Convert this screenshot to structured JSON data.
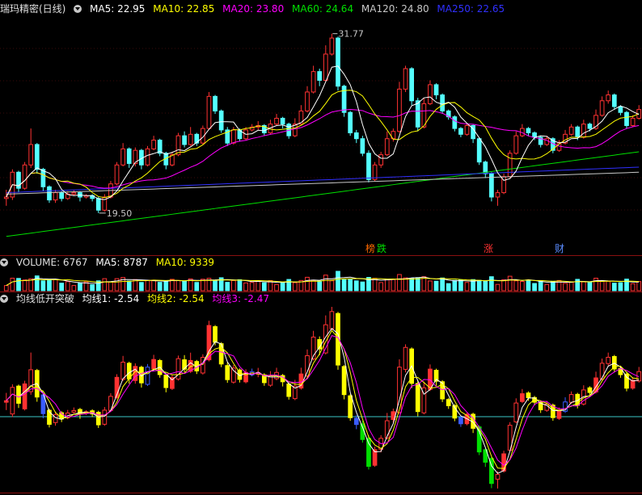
{
  "header": {
    "title": "瑞玛精密(日线)",
    "ma5": "MA5: 22.95",
    "ma10": "MA10: 22.85",
    "ma20": "MA20: 23.80",
    "ma60": "MA60: 24.64",
    "ma120": "MA120: 24.80",
    "ma250": "MA250: 22.65"
  },
  "volume_header": {
    "label": "VOLUME: 6767",
    "ma5": "MA5: 8787",
    "ma10": "MA10: 9339"
  },
  "indicator_header": {
    "label": "均线低开突破",
    "l1": "均线1: -2.54",
    "l2": "均线2: -2.54",
    "l3": "均线3: -2.47"
  },
  "tags": {
    "t1": "榜",
    "t2": "跌",
    "t3": "涨",
    "t4": "财"
  },
  "colors": {
    "up": "#ff3232",
    "down": "#54ffff",
    "ma5": "#ffffff",
    "ma10": "#ffff00",
    "ma20": "#ff00ff",
    "ma60": "#00e000",
    "ma120": "#c8c8c8",
    "ma250": "#3030ff",
    "separator": "#8a1010"
  },
  "chart_data": [
    {
      "type": "candlestick",
      "title": "瑞玛精密(日线)",
      "annotations": [
        {
          "text": "31.77",
          "label": "high"
        },
        {
          "text": "19.50",
          "label": "low"
        }
      ],
      "ylim": [
        17.5,
        33
      ],
      "series": [
        {
          "name": "MA5",
          "value": 22.95
        },
        {
          "name": "MA10",
          "value": 22.85
        },
        {
          "name": "MA20",
          "value": 23.8
        },
        {
          "name": "MA60",
          "value": 24.64
        },
        {
          "name": "MA120",
          "value": 24.8
        },
        {
          "name": "MA250",
          "value": 22.65
        }
      ],
      "candles": [
        [
          20.5,
          20.6,
          21.1,
          20.0
        ],
        [
          20.6,
          22.3,
          22.5,
          20.4
        ],
        [
          22.3,
          21.2,
          22.4,
          20.9
        ],
        [
          21.2,
          22.8,
          23.0,
          21.1
        ],
        [
          22.8,
          24.2,
          25.3,
          22.6
        ],
        [
          24.2,
          22.5,
          24.3,
          22.2
        ],
        [
          22.5,
          21.3,
          22.6,
          21.0
        ],
        [
          21.3,
          20.4,
          21.4,
          20.2
        ],
        [
          20.4,
          20.9,
          21.1,
          20.2
        ],
        [
          20.9,
          20.5,
          21.0,
          20.3
        ],
        [
          20.5,
          20.8,
          21.0,
          20.4
        ],
        [
          20.8,
          20.9,
          21.1,
          20.7
        ],
        [
          20.9,
          20.6,
          21.0,
          20.3
        ],
        [
          20.6,
          20.7,
          20.8,
          20.5
        ],
        [
          20.7,
          20.5,
          20.8,
          20.3
        ],
        [
          20.5,
          19.7,
          20.6,
          19.5
        ],
        [
          19.7,
          20.6,
          20.8,
          19.6
        ],
        [
          20.6,
          21.5,
          21.7,
          20.5
        ],
        [
          21.5,
          22.8,
          23.0,
          21.4
        ],
        [
          22.8,
          23.9,
          24.3,
          22.7
        ],
        [
          23.9,
          22.9,
          24.0,
          22.6
        ],
        [
          22.9,
          23.8,
          24.0,
          22.7
        ],
        [
          23.8,
          22.8,
          23.9,
          22.5
        ],
        [
          22.8,
          23.9,
          24.1,
          22.7
        ],
        [
          23.9,
          24.5,
          24.8,
          23.8
        ],
        [
          24.5,
          23.6,
          24.6,
          23.4
        ],
        [
          23.6,
          22.8,
          23.7,
          22.5
        ],
        [
          22.8,
          23.5,
          23.7,
          22.7
        ],
        [
          23.5,
          24.8,
          25.0,
          23.4
        ],
        [
          24.8,
          24.2,
          25.1,
          24.0
        ],
        [
          24.2,
          24.9,
          25.4,
          24.1
        ],
        [
          24.9,
          24.3,
          25.0,
          24.1
        ],
        [
          24.3,
          25.3,
          25.5,
          24.2
        ],
        [
          25.3,
          27.5,
          27.8,
          25.2
        ],
        [
          27.5,
          26.5,
          27.6,
          26.3
        ],
        [
          26.5,
          25.2,
          26.6,
          25.0
        ],
        [
          25.2,
          24.3,
          25.4,
          24.1
        ],
        [
          24.3,
          25.2,
          25.4,
          24.2
        ],
        [
          25.2,
          24.6,
          25.3,
          24.4
        ],
        [
          24.6,
          25.2,
          25.4,
          24.5
        ],
        [
          25.2,
          25.4,
          25.6,
          25.1
        ],
        [
          25.4,
          25.5,
          25.8,
          25.2
        ],
        [
          25.5,
          25.0,
          25.6,
          24.8
        ],
        [
          25.0,
          25.6,
          25.9,
          24.9
        ],
        [
          25.6,
          26.0,
          26.3,
          25.5
        ],
        [
          26.0,
          25.6,
          26.1,
          25.3
        ],
        [
          25.6,
          24.8,
          25.7,
          24.6
        ],
        [
          24.8,
          25.6,
          26.0,
          24.7
        ],
        [
          25.6,
          26.5,
          26.9,
          25.5
        ],
        [
          26.5,
          27.8,
          28.2,
          26.4
        ],
        [
          27.8,
          29.2,
          29.6,
          27.7
        ],
        [
          29.2,
          28.6,
          29.4,
          28.2
        ],
        [
          28.6,
          30.4,
          31.0,
          28.5
        ],
        [
          30.4,
          31.5,
          31.8,
          30.3
        ],
        [
          31.5,
          28.2,
          31.6,
          27.9
        ],
        [
          28.2,
          26.4,
          28.3,
          26.1
        ],
        [
          26.4,
          25.0,
          26.5,
          24.8
        ],
        [
          25.0,
          24.6,
          25.2,
          24.3
        ],
        [
          24.6,
          23.6,
          24.8,
          23.4
        ],
        [
          23.6,
          21.8,
          23.8,
          21.6
        ],
        [
          21.8,
          22.8,
          23.0,
          21.7
        ],
        [
          22.8,
          23.5,
          23.7,
          22.6
        ],
        [
          23.5,
          24.6,
          25.1,
          23.4
        ],
        [
          24.6,
          25.1,
          25.3,
          24.4
        ],
        [
          25.1,
          28.0,
          28.5,
          25.0
        ],
        [
          28.0,
          29.4,
          29.6,
          27.8
        ],
        [
          29.4,
          27.2,
          29.5,
          26.9
        ],
        [
          27.2,
          25.4,
          27.4,
          25.1
        ],
        [
          25.4,
          27.0,
          27.4,
          25.3
        ],
        [
          27.0,
          28.3,
          28.6,
          26.9
        ],
        [
          28.3,
          27.6,
          28.4,
          27.3
        ],
        [
          27.6,
          26.5,
          27.7,
          26.3
        ],
        [
          26.5,
          26.1,
          26.6,
          25.9
        ],
        [
          26.1,
          25.3,
          26.2,
          25.1
        ],
        [
          25.3,
          24.9,
          25.4,
          24.7
        ],
        [
          24.9,
          25.5,
          25.6,
          24.8
        ],
        [
          25.5,
          24.6,
          25.6,
          24.3
        ],
        [
          24.6,
          23.0,
          24.7,
          22.8
        ],
        [
          23.0,
          22.2,
          23.1,
          21.9
        ],
        [
          22.2,
          20.6,
          22.3,
          20.3
        ],
        [
          20.6,
          20.9,
          21.1,
          20.0
        ],
        [
          20.9,
          22.0,
          22.2,
          20.8
        ],
        [
          22.0,
          23.6,
          23.8,
          21.9
        ],
        [
          23.6,
          24.8,
          25.1,
          23.5
        ],
        [
          24.8,
          25.3,
          25.6,
          24.7
        ],
        [
          25.3,
          25.0,
          25.4,
          24.8
        ],
        [
          25.0,
          24.7,
          25.1,
          24.5
        ],
        [
          24.7,
          24.2,
          24.8,
          24.0
        ],
        [
          24.2,
          24.6,
          24.8,
          24.1
        ],
        [
          24.6,
          23.8,
          24.7,
          23.6
        ],
        [
          23.8,
          24.3,
          24.5,
          23.7
        ],
        [
          24.3,
          24.9,
          25.2,
          24.2
        ],
        [
          24.9,
          25.4,
          25.6,
          24.8
        ],
        [
          25.4,
          24.7,
          25.5,
          24.5
        ],
        [
          24.7,
          25.6,
          25.9,
          24.6
        ],
        [
          25.6,
          25.3,
          25.7,
          25.1
        ],
        [
          25.3,
          26.2,
          26.6,
          25.2
        ],
        [
          26.2,
          27.2,
          27.5,
          26.1
        ],
        [
          27.2,
          27.6,
          27.9,
          27.0
        ],
        [
          27.6,
          26.8,
          27.7,
          26.6
        ],
        [
          26.8,
          26.4,
          26.9,
          26.2
        ],
        [
          26.4,
          25.5,
          26.5,
          25.3
        ],
        [
          25.5,
          26.0,
          26.2,
          25.4
        ],
        [
          26.0,
          26.6,
          26.9,
          25.9
        ]
      ]
    },
    {
      "type": "bar",
      "title": "VOLUME",
      "series": [
        {
          "name": "VOLUME",
          "value": 6767
        },
        {
          "name": "MA5",
          "value": 8787
        },
        {
          "name": "MA10",
          "value": 9339
        }
      ]
    },
    {
      "type": "candlestick",
      "title": "均线低开突破",
      "series": [
        {
          "name": "均线1",
          "value": -2.54
        },
        {
          "name": "均线2",
          "value": -2.54
        },
        {
          "name": "均线3",
          "value": -2.47
        }
      ]
    }
  ]
}
